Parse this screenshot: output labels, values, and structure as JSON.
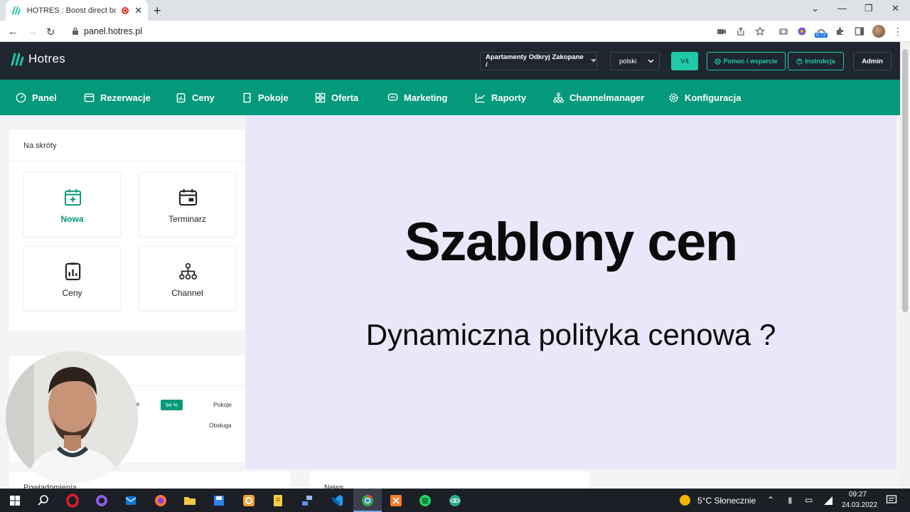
{
  "browser": {
    "tab_title": "HOTRES : Boost direct booki",
    "tab_close": "✕",
    "new_tab": "+",
    "url": "panel.hotres.pl",
    "extension_badge": "0.72",
    "controls": {
      "minimize": "—",
      "maximize": "❐",
      "close": "✕",
      "dropdown": "⌄"
    }
  },
  "header": {
    "logo_text": "Hotres",
    "property_select": "Apartamenty Odkryj Zakopane /",
    "language_select": "polski",
    "version_button": "V4",
    "help_button": "Pomoc i wsparcie",
    "instruction_button": "Instrukcja",
    "admin_button": "Admin"
  },
  "nav": {
    "items": [
      {
        "label": "Panel",
        "icon": "dashboard-icon"
      },
      {
        "label": "Rezerwacje",
        "icon": "reservation-icon"
      },
      {
        "label": "Ceny",
        "icon": "prices-icon"
      },
      {
        "label": "Pokoje",
        "icon": "door-icon"
      },
      {
        "label": "Oferta",
        "icon": "offer-icon"
      },
      {
        "label": "Marketing",
        "icon": "marketing-icon"
      },
      {
        "label": "Raporty",
        "icon": "chart-icon"
      },
      {
        "label": "Channelmanager",
        "icon": "network-icon"
      },
      {
        "label": "Konfiguracja",
        "icon": "gear-icon"
      }
    ]
  },
  "shortcuts": {
    "title": "Na skróty",
    "tiles": [
      {
        "label": "Nowa",
        "icon": "calendar-plus-icon"
      },
      {
        "label": "Terminarz",
        "icon": "schedule-icon"
      },
      {
        "label": "Ceny",
        "icon": "prices-clipboard-icon"
      },
      {
        "label": "Channel",
        "icon": "network-icon"
      }
    ]
  },
  "stats": {
    "label_fragment": "ie",
    "percent_badge": "94 %",
    "rooms_label": "Pokoje",
    "service_label": "Obsługa"
  },
  "notifications": {
    "title": "Powiadomienia"
  },
  "news": {
    "title": "News"
  },
  "slide": {
    "title": "Szablony cen",
    "subtitle": "Dynamiczna polityka cenowa ?"
  },
  "taskbar": {
    "weather": "5°C  Słonecznie",
    "time": "09:27",
    "date": "24.03.2022"
  },
  "colors": {
    "brand_green": "#04997a",
    "accent_teal": "#20c9a7",
    "header_dark": "#1f2630",
    "slide_bg": "#e8e8fa"
  }
}
